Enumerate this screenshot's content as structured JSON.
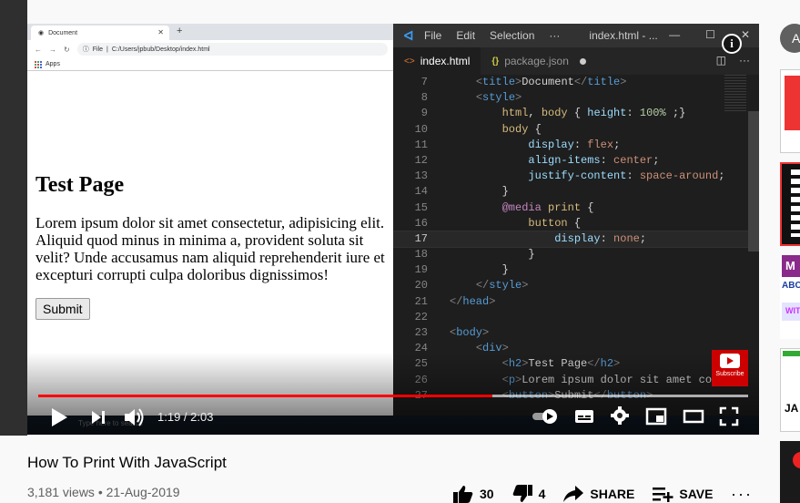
{
  "browser": {
    "tab_title": "Document",
    "address_label": "File",
    "address": "C:/Users/jpbub/Desktop/index.html",
    "bookmark_apps": "Apps"
  },
  "demo_page": {
    "heading": "Test Page",
    "paragraph": "Lorem ipsum dolor sit amet consectetur, adipisicing elit. Aliquid quod minus in minima a, provident soluta sit velit? Unde accusamus nam aliquid reprehenderit iure et excepturi corrupti culpa doloribus dignissimos!",
    "button": "Submit"
  },
  "editor": {
    "menu": [
      "File",
      "Edit",
      "Selection",
      "···"
    ],
    "window_title": "index.html - ...",
    "tabs": [
      {
        "label": "index.html",
        "icon": "html-file-icon",
        "active": true
      },
      {
        "label": "package.json",
        "icon": "json-file-icon",
        "active": false,
        "modified": true
      }
    ],
    "code_lines": [
      {
        "n": "7",
        "indent": 1,
        "tokens": [
          [
            "br",
            "<"
          ],
          [
            "tag",
            "title"
          ],
          [
            "br",
            ">"
          ],
          [
            "text",
            "Document"
          ],
          [
            "br",
            "</"
          ],
          [
            "tag",
            "title"
          ],
          [
            "br",
            ">"
          ]
        ]
      },
      {
        "n": "8",
        "indent": 1,
        "tokens": [
          [
            "br",
            "<"
          ],
          [
            "tag",
            "style"
          ],
          [
            "br",
            ">"
          ]
        ]
      },
      {
        "n": "9",
        "indent": 2,
        "tokens": [
          [
            "sel",
            "html"
          ],
          [
            "text",
            ", "
          ],
          [
            "sel",
            "body"
          ],
          [
            "text",
            " { "
          ],
          [
            "prop",
            "height"
          ],
          [
            "text",
            ": "
          ],
          [
            "num",
            "100%"
          ],
          [
            "text",
            " ;}"
          ]
        ]
      },
      {
        "n": "10",
        "indent": 2,
        "tokens": [
          [
            "sel",
            "body"
          ],
          [
            "text",
            " {"
          ]
        ]
      },
      {
        "n": "11",
        "indent": 3,
        "tokens": [
          [
            "prop",
            "display"
          ],
          [
            "text",
            ": "
          ],
          [
            "val",
            "flex"
          ],
          [
            "text",
            ";"
          ]
        ]
      },
      {
        "n": "12",
        "indent": 3,
        "tokens": [
          [
            "prop",
            "align-items"
          ],
          [
            "text",
            ": "
          ],
          [
            "val",
            "center"
          ],
          [
            "text",
            ";"
          ]
        ]
      },
      {
        "n": "13",
        "indent": 3,
        "tokens": [
          [
            "prop",
            "justify-content"
          ],
          [
            "text",
            ": "
          ],
          [
            "val",
            "space-around"
          ],
          [
            "text",
            ";"
          ]
        ]
      },
      {
        "n": "14",
        "indent": 2,
        "tokens": [
          [
            "text",
            "}"
          ]
        ]
      },
      {
        "n": "15",
        "indent": 2,
        "tokens": [
          [
            "at",
            "@media"
          ],
          [
            "text",
            " "
          ],
          [
            "sel",
            "print"
          ],
          [
            "text",
            " {"
          ]
        ]
      },
      {
        "n": "16",
        "indent": 3,
        "tokens": [
          [
            "sel",
            "button"
          ],
          [
            "text",
            " {"
          ]
        ]
      },
      {
        "n": "17",
        "indent": 4,
        "cur": true,
        "tokens": [
          [
            "prop",
            "display"
          ],
          [
            "text",
            ": "
          ],
          [
            "val",
            "none"
          ],
          [
            "text",
            ";"
          ]
        ]
      },
      {
        "n": "18",
        "indent": 3,
        "tokens": [
          [
            "text",
            "}"
          ]
        ]
      },
      {
        "n": "19",
        "indent": 2,
        "tokens": [
          [
            "text",
            "}"
          ]
        ]
      },
      {
        "n": "20",
        "indent": 1,
        "tokens": [
          [
            "br",
            "</"
          ],
          [
            "tag",
            "style"
          ],
          [
            "br",
            ">"
          ]
        ]
      },
      {
        "n": "21",
        "indent": 0,
        "tokens": [
          [
            "br",
            "</"
          ],
          [
            "tag",
            "head"
          ],
          [
            "br",
            ">"
          ]
        ]
      },
      {
        "n": "22",
        "indent": 0,
        "tokens": []
      },
      {
        "n": "23",
        "indent": 0,
        "tokens": [
          [
            "br",
            "<"
          ],
          [
            "tag",
            "body"
          ],
          [
            "br",
            ">"
          ]
        ]
      },
      {
        "n": "24",
        "indent": 1,
        "tokens": [
          [
            "br",
            "<"
          ],
          [
            "tag",
            "div"
          ],
          [
            "br",
            ">"
          ]
        ]
      },
      {
        "n": "25",
        "indent": 2,
        "tokens": [
          [
            "br",
            "<"
          ],
          [
            "tag",
            "h2"
          ],
          [
            "br",
            ">"
          ],
          [
            "text",
            "Test Page"
          ],
          [
            "br",
            "</"
          ],
          [
            "tag",
            "h2"
          ],
          [
            "br",
            ">"
          ]
        ]
      },
      {
        "n": "26",
        "indent": 2,
        "tokens": [
          [
            "br",
            "<"
          ],
          [
            "tag",
            "p"
          ],
          [
            "br",
            ">"
          ],
          [
            "text",
            "Lorem ipsum dolor sit amet consec"
          ]
        ]
      },
      {
        "n": "27",
        "indent": 2,
        "tokens": [
          [
            "br",
            "<"
          ],
          [
            "tag",
            "button"
          ],
          [
            "br",
            ">"
          ],
          [
            "text",
            "Submit"
          ],
          [
            "br",
            "</"
          ],
          [
            "tag",
            "button"
          ],
          [
            "br",
            ">"
          ]
        ]
      }
    ]
  },
  "player": {
    "time": "1:19 / 2:03",
    "played_fraction": 0.64,
    "loaded_fraction": 1.0,
    "taskbar_search": "Type here to search",
    "watermark_label": "Subscribe",
    "info_glyph": "i"
  },
  "video": {
    "title": "How To Print With JavaScript",
    "meta": "3,181 views • 21-Aug-2019",
    "likes": "30",
    "dislikes": "4",
    "share": "SHARE",
    "save": "SAVE",
    "more": "···"
  },
  "sidebar": {
    "avatar_letter": "A",
    "thumb3_a": "M",
    "thumb3_b": "ABC",
    "thumb3_c": "WIT",
    "thumb4_text": "JA"
  },
  "colors": {
    "progress_played": "#ff0000",
    "vscode_bg": "#1e1e1e",
    "page_bg": "#f9f9f9"
  }
}
